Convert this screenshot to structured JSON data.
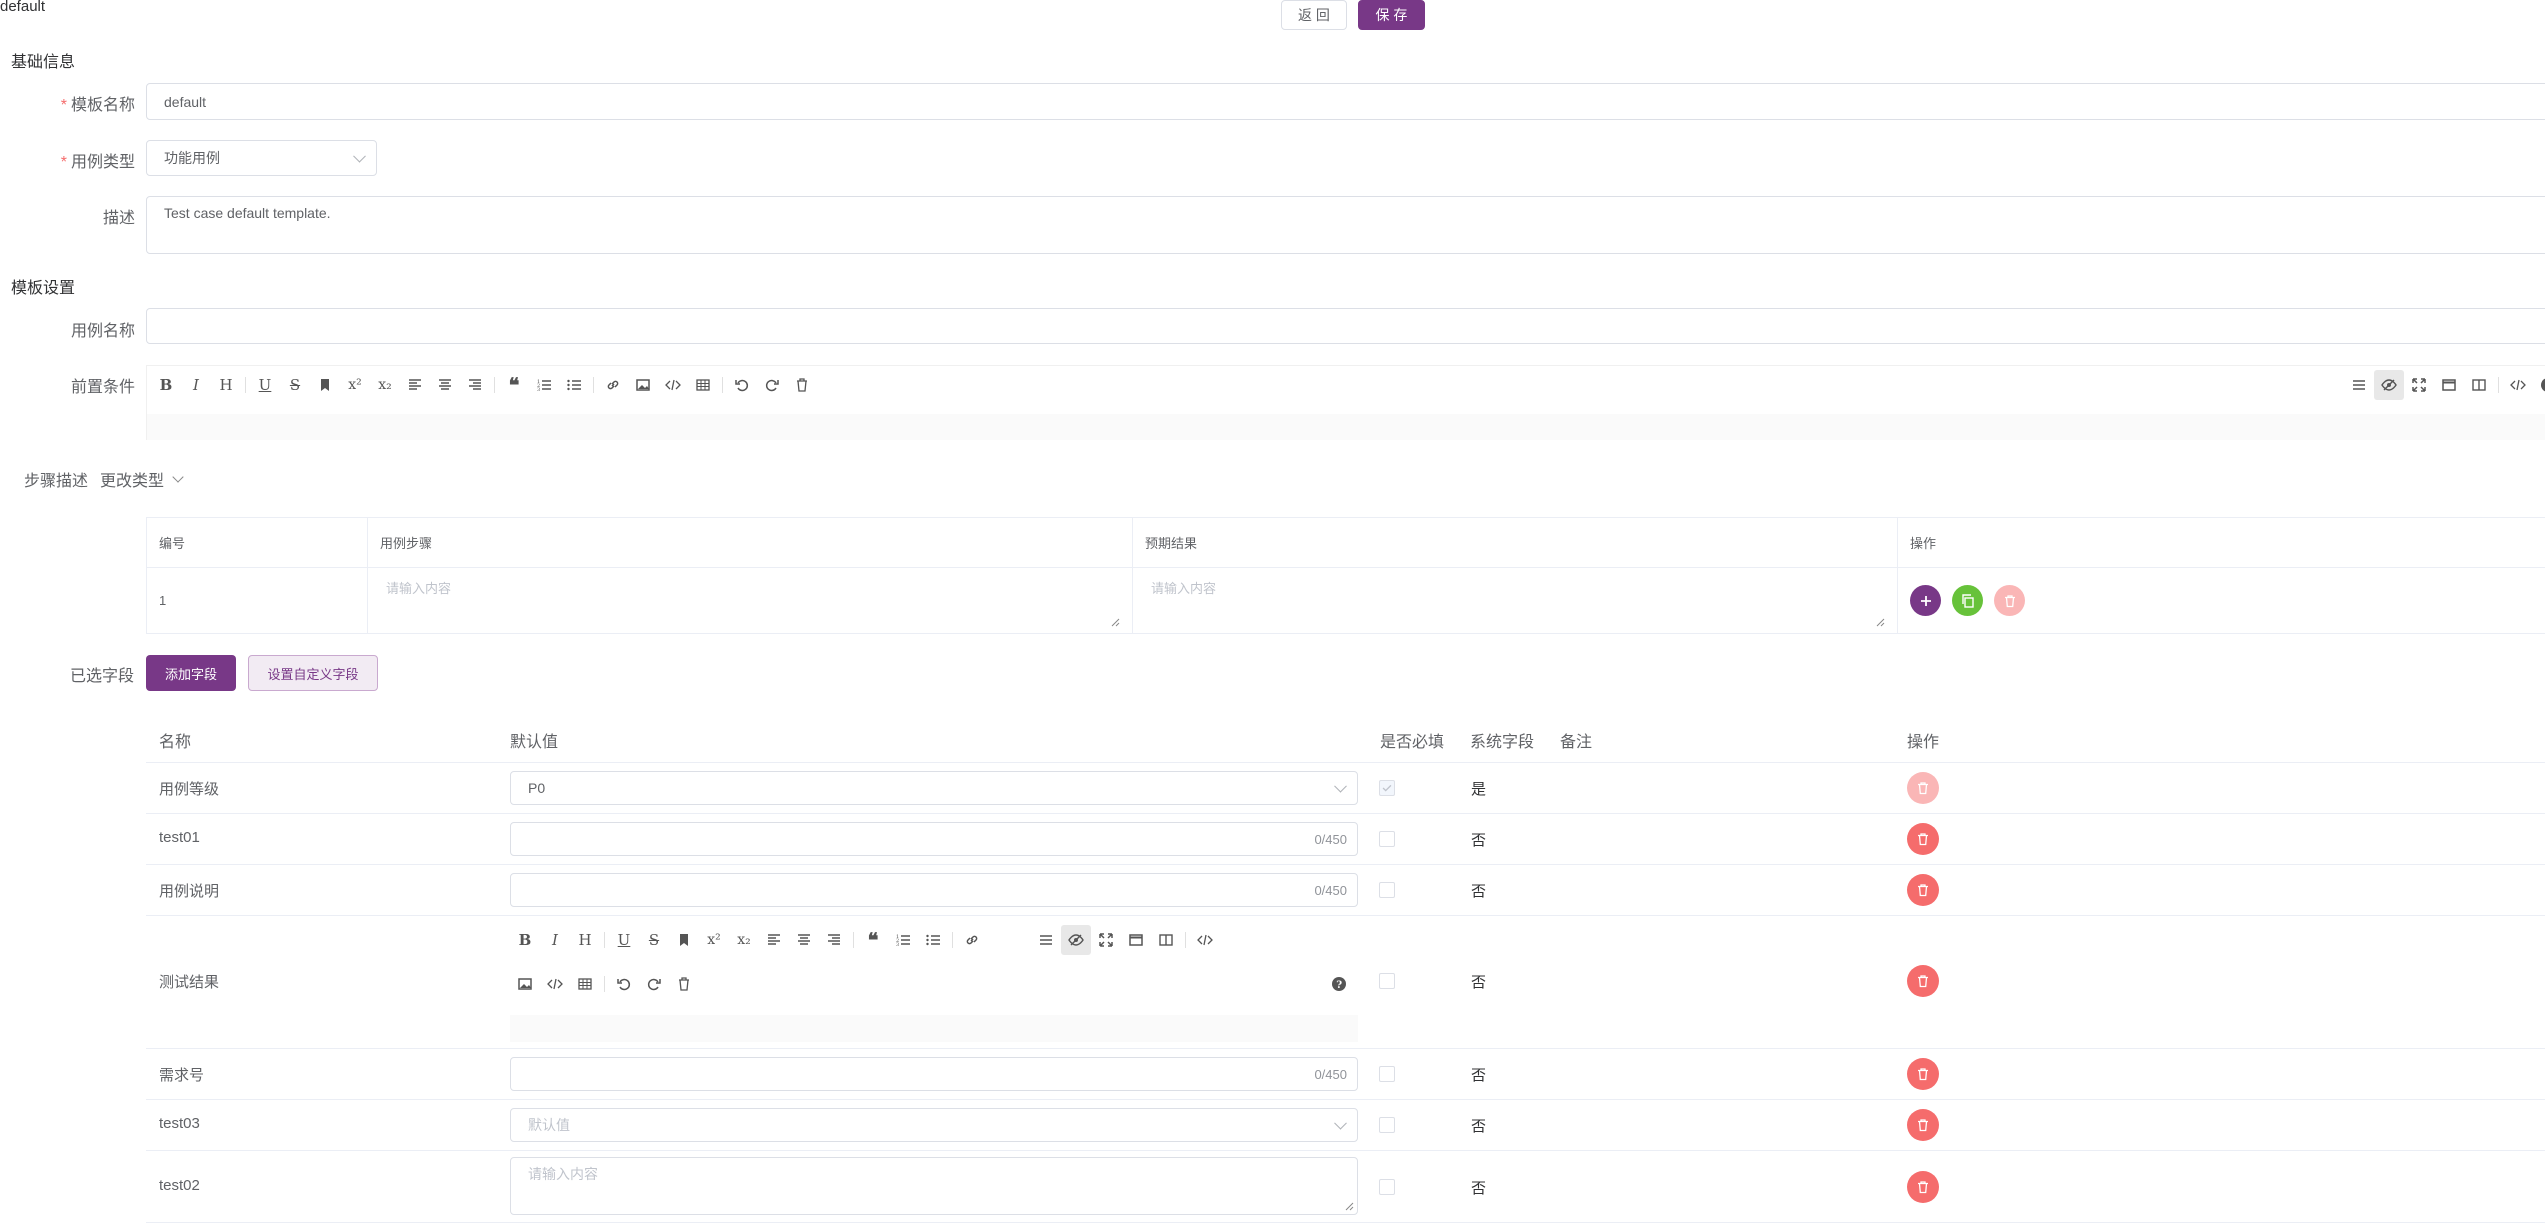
{
  "page": {
    "title": "default",
    "back_label": "返 回",
    "save_label": "保 存"
  },
  "basic": {
    "section_title": "基础信息",
    "name_label": "模板名称",
    "name_value": "default",
    "type_label": "用例类型",
    "type_value": "功能用例",
    "desc_label": "描述",
    "desc_value": "Test case default template."
  },
  "template": {
    "section_title": "模板设置",
    "case_name_label": "用例名称",
    "case_name_value": "",
    "precondition_label": "前置条件"
  },
  "steps": {
    "label": "步骤描述",
    "change_type": "更改类型",
    "columns": [
      "编号",
      "用例步骤",
      "预期结果",
      "操作"
    ],
    "rows": [
      {
        "index": "1",
        "step_placeholder": "请输入内容",
        "result_placeholder": "请输入内容"
      }
    ]
  },
  "fields": {
    "label": "已选字段",
    "add_button": "添加字段",
    "custom_button": "设置自定义字段",
    "columns": {
      "name": "名称",
      "default": "默认值",
      "required": "是否必填",
      "system": "系统字段",
      "remark": "备注",
      "action": "操作"
    },
    "rows": [
      {
        "name": "用例等级",
        "kind": "select",
        "value": "P0",
        "required": true,
        "system": "是",
        "deletable": false
      },
      {
        "name": "test01",
        "kind": "text",
        "value": "",
        "counter": "0/450",
        "required": false,
        "system": "否",
        "deletable": true
      },
      {
        "name": "用例说明",
        "kind": "text",
        "value": "",
        "counter": "0/450",
        "required": false,
        "system": "否",
        "deletable": true
      },
      {
        "name": "测试结果",
        "kind": "richtext",
        "required": false,
        "system": "否",
        "deletable": true
      },
      {
        "name": "需求号",
        "kind": "text",
        "value": "",
        "counter": "0/450",
        "required": false,
        "system": "否",
        "deletable": true
      },
      {
        "name": "test03",
        "kind": "select",
        "placeholder": "默认值",
        "required": false,
        "system": "否",
        "deletable": true
      },
      {
        "name": "test02",
        "kind": "textarea",
        "placeholder": "请输入内容",
        "required": false,
        "system": "否",
        "deletable": true
      }
    ]
  },
  "colors": {
    "primary": "#783887",
    "danger": "#f56c6c",
    "success": "#67c23a"
  },
  "icons": [
    "bold-icon",
    "italic-icon",
    "heading-icon",
    "underline-icon",
    "strikethrough-icon",
    "bookmark-icon",
    "superscript-icon",
    "subscript-icon",
    "align-left-icon",
    "align-center-icon",
    "align-right-icon",
    "quote-icon",
    "ordered-list-icon",
    "unordered-list-icon",
    "link-icon",
    "image-icon",
    "code-icon",
    "table-icon",
    "undo-icon",
    "redo-icon",
    "trash-icon",
    "menu-icon",
    "preview-icon",
    "fullscreen-icon",
    "window-icon",
    "split-icon",
    "html-icon",
    "help-icon"
  ]
}
